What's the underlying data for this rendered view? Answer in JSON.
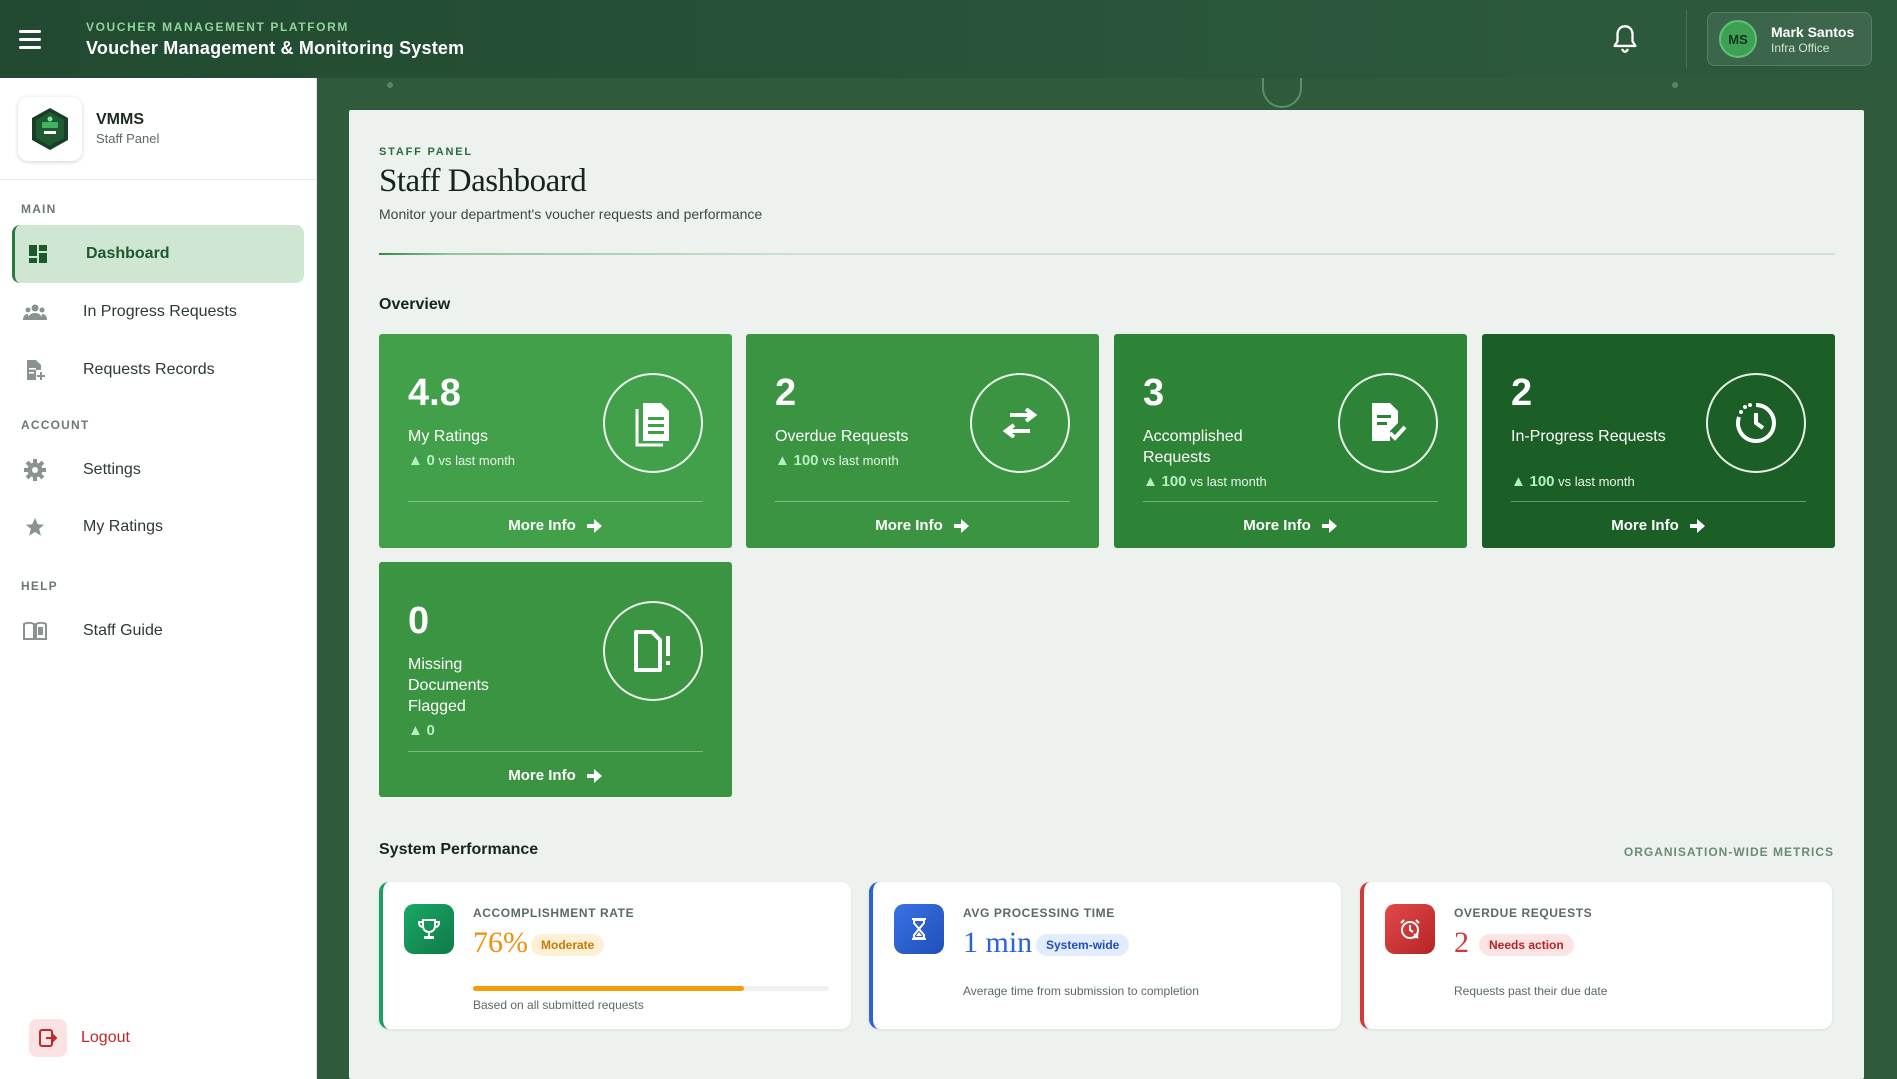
{
  "header": {
    "platform_label": "VOUCHER MANAGEMENT PLATFORM",
    "system_title": "Voucher Management & Monitoring System",
    "user": {
      "initials": "MS",
      "name": "Mark Santos",
      "role": "Infra Office"
    }
  },
  "sidebar": {
    "app_name": "VMMS",
    "panel_name": "Staff Panel",
    "sections": {
      "main": "MAIN",
      "account": "ACCOUNT",
      "help": "HELP"
    },
    "items": [
      {
        "label": "Dashboard",
        "icon": "dashboard-icon",
        "active": true
      },
      {
        "label": "In Progress Requests",
        "icon": "people-icon"
      },
      {
        "label": "Requests Records",
        "icon": "document-add-icon"
      },
      {
        "label": "Settings",
        "icon": "gear-icon"
      },
      {
        "label": "My Ratings",
        "icon": "star-icon"
      },
      {
        "label": "Staff Guide",
        "icon": "book-icon"
      }
    ],
    "logout_label": "Logout"
  },
  "page": {
    "eyebrow": "STAFF PANEL",
    "title": "Staff Dashboard",
    "subtitle": "Monitor your department's voucher requests and performance"
  },
  "overview": {
    "title": "Overview",
    "cards": [
      {
        "value": "4.8",
        "label": "My Ratings",
        "trend_value": "0",
        "trend_text": "vs last month",
        "more": "More Info",
        "color": "#43a04a",
        "icon": "document-icon"
      },
      {
        "value": "2",
        "label": "Overdue Requests",
        "trend_value": "100",
        "trend_text": "vs last month",
        "more": "More Info",
        "color": "#3a9441",
        "icon": "swap-arrows-icon"
      },
      {
        "value": "3",
        "label": "Accomplished Requests",
        "trend_value": "100",
        "trend_text": "vs last month",
        "more": "More Info",
        "color": "#2e8436",
        "icon": "document-check-icon"
      },
      {
        "value": "2",
        "label": "In-Progress Requests",
        "trend_value": "100",
        "trend_text": "vs last month",
        "more": "More Info",
        "color": "#1c5f26",
        "icon": "clock-icon"
      },
      {
        "value": "0",
        "label": "Missing Documents Flagged",
        "trend_value": "0",
        "trend_text": "",
        "more": "More Info",
        "color": "#3a9441",
        "icon": "document-alert-icon"
      }
    ]
  },
  "performance": {
    "title": "System Performance",
    "right_label": "ORGANISATION-WIDE METRICS",
    "cards": [
      {
        "label": "ACCOMPLISHMENT RATE",
        "value": "76%",
        "badge": "Moderate",
        "note": "Based on all submitted requests",
        "progress": 0.76,
        "accent": "#1e9e62",
        "value_color": "#f0900a",
        "icon": "trophy-icon"
      },
      {
        "label": "AVG PROCESSING TIME",
        "value": "1 min",
        "badge": "System-wide",
        "note": "Average time from submission to completion",
        "accent": "#2b63d9",
        "value_color": "#2b63d9",
        "icon": "hourglass-icon"
      },
      {
        "label": "OVERDUE REQUESTS",
        "value": "2",
        "badge": "Needs action",
        "note": "Requests past their due date",
        "accent": "#d23a3a",
        "value_color": "#d23a3a",
        "icon": "alarm-clock-icon"
      }
    ]
  }
}
